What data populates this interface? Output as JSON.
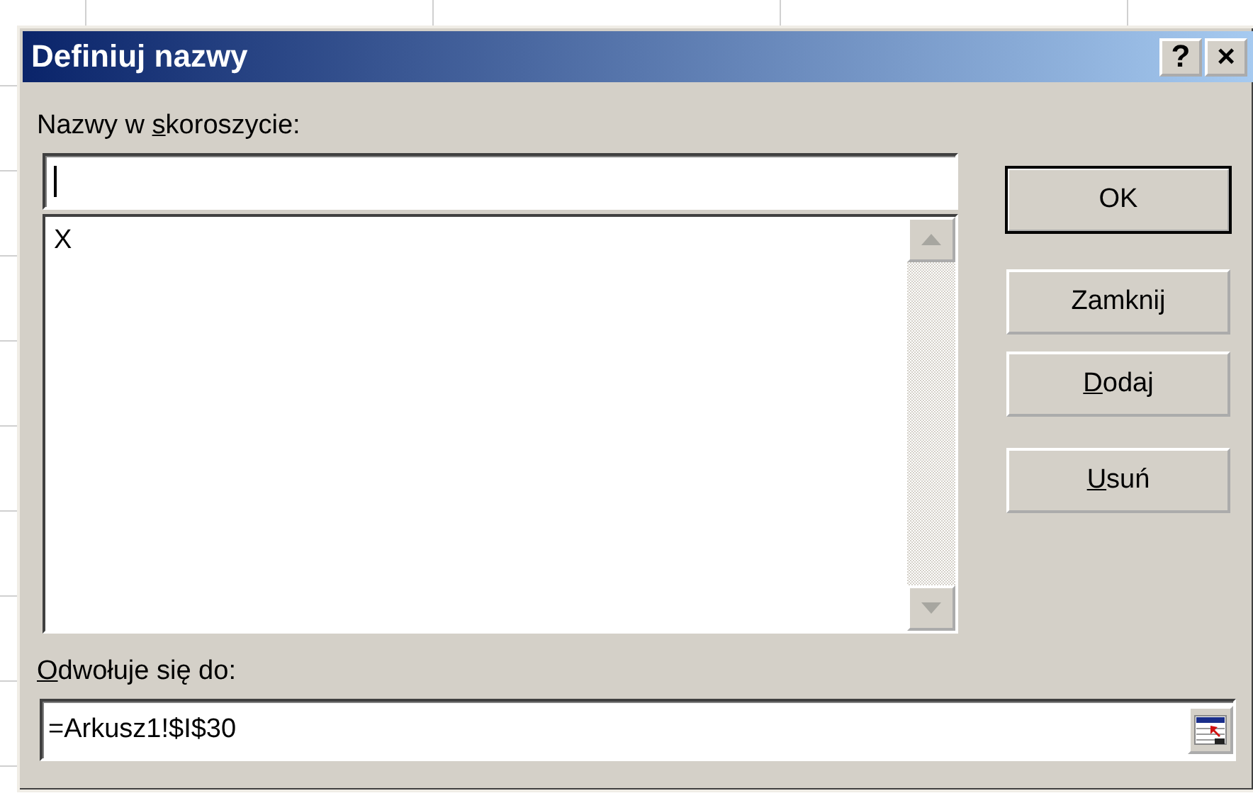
{
  "window": {
    "title": "Definiuj nazwy",
    "title_buttons": [
      "?",
      "×"
    ]
  },
  "names_label": {
    "segments": [
      {
        "text": "Nazwy w ",
        "underlined": false
      },
      {
        "text": "s",
        "underlined": true
      },
      {
        "text": "koroszycie:",
        "underlined": false
      }
    ]
  },
  "names_list": {
    "items": [
      {
        "label": "X",
        "selected": false
      }
    ]
  },
  "buttons": [
    {
      "segments": [
        {
          "text": "OK",
          "underlined": false
        }
      ],
      "default": true
    },
    {
      "segments": [
        {
          "text": "Zamknij",
          "underlined": false
        }
      ],
      "default": false
    },
    {
      "segments": [
        {
          "text": "D",
          "underlined": true
        },
        {
          "text": "odaj",
          "underlined": false
        }
      ],
      "default": false
    },
    {
      "segments": [
        {
          "text": "U",
          "underlined": true
        },
        {
          "text": "suń",
          "underlined": false
        }
      ],
      "default": false
    }
  ],
  "refers_label": {
    "segments": [
      {
        "text": "O",
        "underlined": true
      },
      {
        "text": "dwołuje się do:",
        "underlined": false
      }
    ]
  },
  "refers_input": {
    "value": "=Arkusz1!$I$30"
  }
}
